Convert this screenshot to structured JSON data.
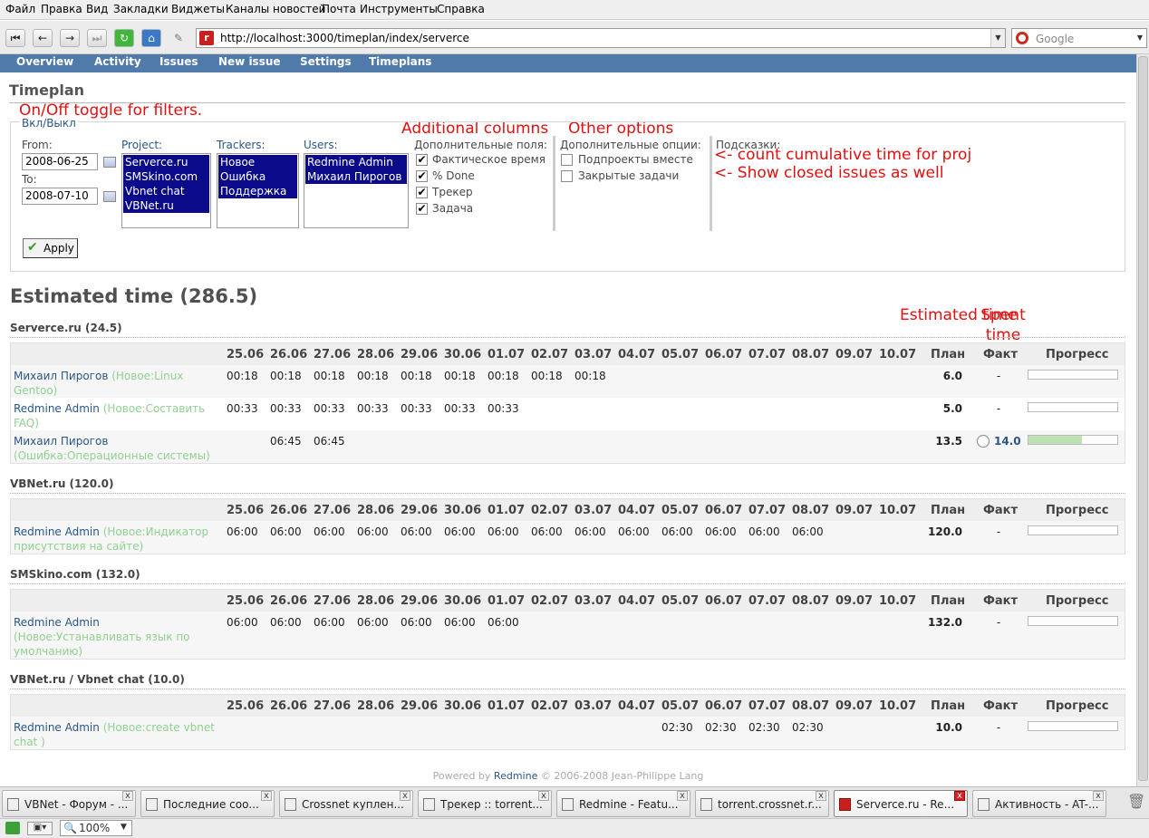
{
  "browser": {
    "menu": [
      "Файл",
      "Правка",
      "Вид",
      "Закладки",
      "Виджеты",
      "Каналы новостей",
      "Почта",
      "Инструменты",
      "Справка"
    ],
    "url": "http://localhost:3000/timeplan/index/serverce",
    "search_placeholder": "Google"
  },
  "redmine": {
    "menu": [
      "Overview",
      "Activity",
      "Issues",
      "New issue",
      "Settings",
      "Timeplans"
    ],
    "page_title": "Timeplan",
    "toggle_link": "Вкл/Выкл",
    "filters": {
      "from_label": "From:",
      "from_value": "2008-06-25",
      "to_label": "To:",
      "to_value": "2008-07-10",
      "project_label": "Project:",
      "projects": [
        "Serverce.ru",
        "SMSkino.com",
        "Vbnet chat",
        "VBNet.ru"
      ],
      "trackers_label": "Trackers:",
      "trackers": [
        "Новое",
        "Ошибка",
        "Поддержка"
      ],
      "users_label": "Users:",
      "users": [
        "Redmine Admin",
        "Михаил Пирогов"
      ],
      "additional_fields_label": "Дополнительные поля:",
      "additional_fields": [
        {
          "label": "Фактическое время",
          "checked": true
        },
        {
          "label": "% Done",
          "checked": true
        },
        {
          "label": "Трекер",
          "checked": true
        },
        {
          "label": "Задача",
          "checked": true
        }
      ],
      "additional_options_label": "Дополнительные опции:",
      "additional_options": [
        {
          "label": "Подпроекты вместе",
          "checked": false
        },
        {
          "label": "Закрытые задачи",
          "checked": false
        }
      ],
      "hints_label": "Подсказки:",
      "apply_label": "Apply"
    },
    "annotations": {
      "toggle": "On/Off toggle for filters.",
      "additional_columns": "Additional columns",
      "other_options": "Other options",
      "cumulative": "<- count cumulative time for proj",
      "closed": "<- Show closed issues as well",
      "estimated": "Estimated time",
      "spent": "Spent time"
    },
    "estimated_title": "Estimated time (286.5)",
    "days": [
      "25.06",
      "26.06",
      "27.06",
      "28.06",
      "29.06",
      "30.06",
      "01.07",
      "02.07",
      "03.07",
      "04.07",
      "05.07",
      "06.07",
      "07.07",
      "08.07",
      "09.07",
      "10.07"
    ],
    "col_plan": "План",
    "col_fact": "Факт",
    "col_progress": "Прогресс",
    "projects": [
      {
        "title": "Serverce.ru (24.5)",
        "rows": [
          {
            "user": "Михаил Пирогов",
            "issue": "(Новое:Linux Gentoo)",
            "days": [
              "00:18",
              "00:18",
              "00:18",
              "00:18",
              "00:18",
              "00:18",
              "00:18",
              "00:18",
              "00:18",
              "",
              "",
              "",
              "",
              "",
              "",
              ""
            ],
            "plan": "6.0",
            "fact": "-",
            "progress": 0
          },
          {
            "user": "Redmine Admin",
            "issue": "(Новое:Составить FAQ)",
            "days": [
              "00:33",
              "00:33",
              "00:33",
              "00:33",
              "00:33",
              "00:33",
              "00:33",
              "",
              "",
              "",
              "",
              "",
              "",
              "",
              "",
              ""
            ],
            "plan": "5.0",
            "fact": "-",
            "progress": 0
          },
          {
            "user": "Михаил Пирогов",
            "issue": "(Ошибка:Операционные системы)",
            "days": [
              "",
              "06:45",
              "06:45",
              "",
              "",
              "",
              "",
              "",
              "",
              "",
              "",
              "",
              "",
              "",
              "",
              ""
            ],
            "plan": "13.5",
            "fact": "14.0",
            "progress": 60
          }
        ]
      },
      {
        "title": "VBNet.ru (120.0)",
        "rows": [
          {
            "user": "Redmine Admin",
            "issue": "(Новое:Индикатор присутствия на сайте)",
            "days": [
              "06:00",
              "06:00",
              "06:00",
              "06:00",
              "06:00",
              "06:00",
              "06:00",
              "06:00",
              "06:00",
              "06:00",
              "06:00",
              "06:00",
              "06:00",
              "06:00",
              "",
              ""
            ],
            "plan": "120.0",
            "fact": "-",
            "progress": 0
          }
        ]
      },
      {
        "title": "SMSkino.com (132.0)",
        "rows": [
          {
            "user": "Redmine Admin",
            "issue": "(Новое:Устанавливать язык по умолчанию)",
            "days": [
              "06:00",
              "06:00",
              "06:00",
              "06:00",
              "06:00",
              "06:00",
              "06:00",
              "",
              "",
              "",
              "",
              "",
              "",
              "",
              "",
              ""
            ],
            "plan": "132.0",
            "fact": "-",
            "progress": 0
          }
        ]
      },
      {
        "title": "VBNet.ru / Vbnet chat (10.0)",
        "rows": [
          {
            "user": "Redmine Admin",
            "issue": "(Новое:create vbnet chat )",
            "days": [
              "",
              "",
              "",
              "",
              "",
              "",
              "",
              "",
              "",
              "",
              "02:30",
              "02:30",
              "02:30",
              "02:30",
              "",
              ""
            ],
            "plan": "10.0",
            "fact": "-",
            "progress": 0
          }
        ]
      }
    ],
    "footer_prefix": "Powered by",
    "footer_link": "Redmine",
    "footer_suffix": "© 2006-2008 Jean-Philippe Lang"
  },
  "taskbar": [
    "VBNet - Форум - ...",
    "Последние соо...",
    "Crossnet куплен...",
    "Трекер :: torrent...",
    "Redmine - Featu...",
    "torrent.crossnet.r...",
    "Serverce.ru - Re...",
    "Активность - AT-..."
  ],
  "status": {
    "zoom": "100%"
  }
}
